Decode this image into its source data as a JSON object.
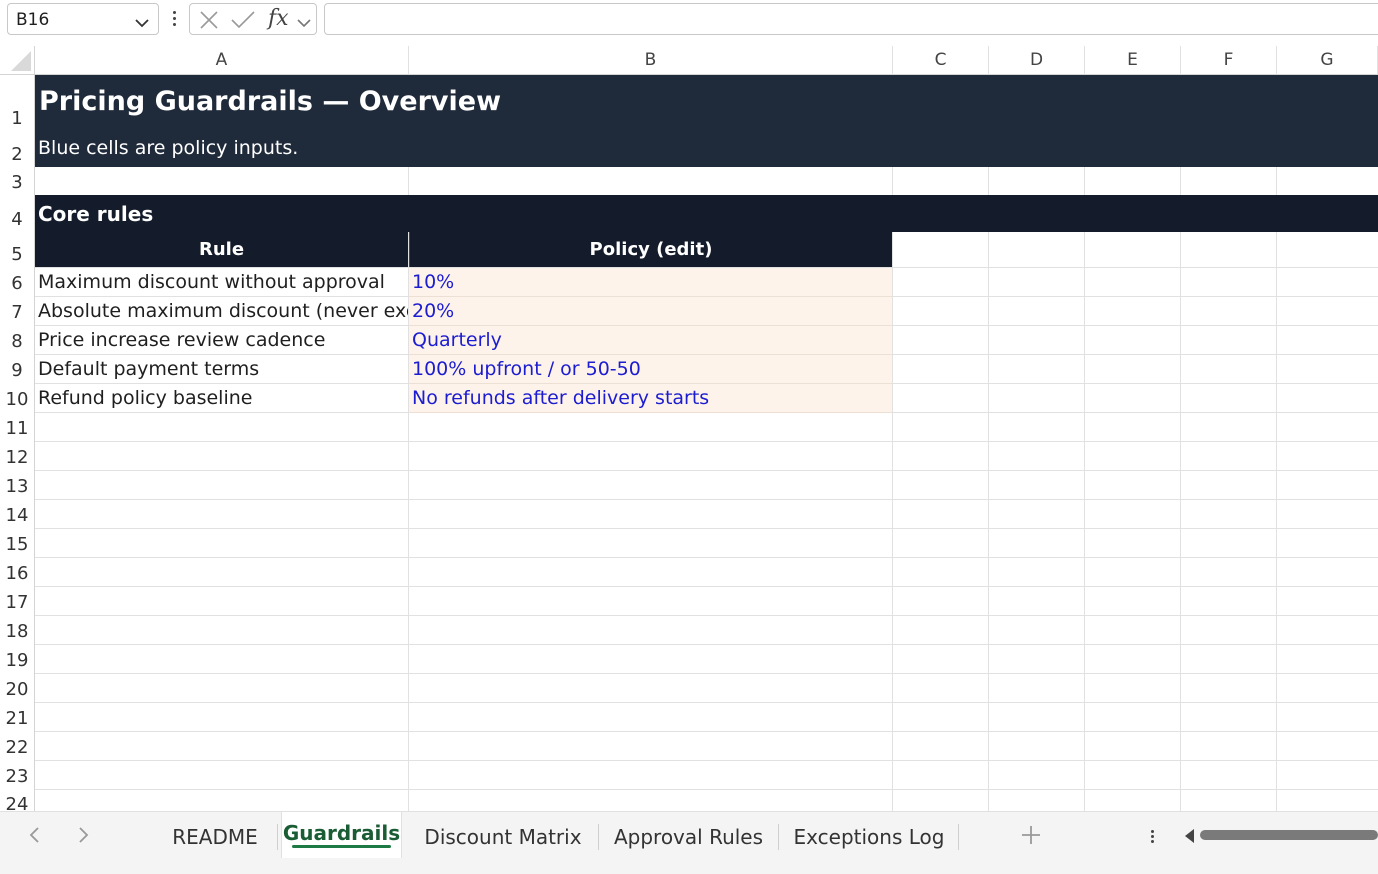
{
  "formula_bar": {
    "name_box": "B16",
    "function_label": "fx",
    "formula": ""
  },
  "columns": [
    "A",
    "B",
    "C",
    "D",
    "E",
    "F",
    "G"
  ],
  "rows": [
    "1",
    "2",
    "3",
    "4",
    "5",
    "6",
    "7",
    "8",
    "9",
    "10",
    "11",
    "12",
    "13",
    "14",
    "15",
    "16",
    "17",
    "18",
    "19",
    "20",
    "21",
    "22",
    "23",
    "24"
  ],
  "sheet": {
    "title": "Pricing Guardrails — Overview",
    "subtitle": "Blue cells are policy inputs.",
    "section": "Core rules",
    "table_headers": [
      "Rule",
      "Policy (edit)"
    ],
    "table_rows": [
      {
        "rule": "Maximum discount without approval",
        "policy": "10%"
      },
      {
        "rule": "Absolute maximum discount (never exceed)",
        "policy": "20%"
      },
      {
        "rule": "Price increase review cadence",
        "policy": "Quarterly"
      },
      {
        "rule": "Default payment terms",
        "policy": "100% upfront / or 50-50"
      },
      {
        "rule": "Refund policy baseline",
        "policy": "No refunds after delivery starts"
      }
    ]
  },
  "sheet_tabs": [
    "README",
    "Guardrails",
    "Discount Matrix",
    "Approval Rules",
    "Exceptions Log"
  ],
  "active_tab": "Guardrails",
  "colors": {
    "title_band": "#1f2a3a",
    "header_band": "#141c2b",
    "input_fill": "#fdf3ea",
    "input_text": "#1c1cd0",
    "active_tab_accent": "#1e7a44"
  },
  "icons": {
    "name_box_dropdown": "chevron-down-icon",
    "cancel": "close-icon",
    "enter": "check-icon",
    "function": "fx-icon",
    "prev_sheet": "chevron-left-icon",
    "next_sheet": "chevron-right-icon",
    "add_sheet": "plus-icon",
    "more": "more-vertical-icon"
  }
}
